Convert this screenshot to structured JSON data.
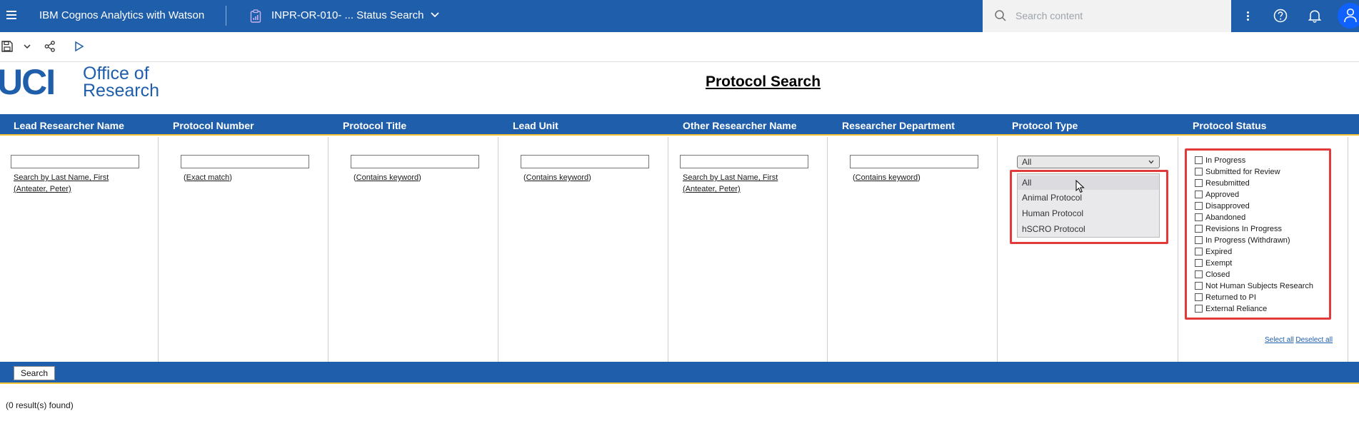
{
  "topbar": {
    "app_title": "IBM Cognos Analytics with Watson",
    "report_title": "INPR-OR-010- ... Status Search",
    "search_placeholder": "Search content",
    "brand_color": "#1f5eaa"
  },
  "logo": {
    "uci": "UCI",
    "office_line1": "Office of",
    "office_line2": "Research"
  },
  "page_title": "Protocol Search",
  "columns": [
    {
      "header": "Lead Researcher Name",
      "hint_line1": "Search by Last Name, First",
      "hint_line2": "(Anteater, Peter)"
    },
    {
      "header": "Protocol Number",
      "hint_prefix": "(",
      "hint_link": "Exact match",
      "hint_suffix": ")"
    },
    {
      "header": "Protocol Title",
      "hint_prefix": "(",
      "hint_link": "Contains keyword",
      "hint_suffix": ")"
    },
    {
      "header": "Lead Unit",
      "hint_prefix": "(",
      "hint_link": "Contains keyword",
      "hint_suffix": ")"
    },
    {
      "header": "Other Researcher Name",
      "hint_line1": "Search by Last Name, First",
      "hint_line2": "(Anteater, Peter)"
    },
    {
      "header": "Researcher Department",
      "hint_prefix": "(",
      "hint_link": "Contains keyword",
      "hint_suffix": ")"
    },
    {
      "header": "Protocol Type"
    },
    {
      "header": "Protocol Status"
    }
  ],
  "protocol_type": {
    "selected": "All",
    "options": [
      "All",
      "Animal Protocol",
      "Human Protocol",
      "hSCRO Protocol"
    ]
  },
  "protocol_status": {
    "options": [
      "In Progress",
      "Submitted for Review",
      "Resubmitted",
      "Approved",
      "Disapproved",
      "Abandoned",
      "Revisions In Progress",
      "In Progress (Withdrawn)",
      "Expired",
      "Exempt",
      "Closed",
      "Not Human Subjects Research",
      "Returned to PI",
      "External Reliance"
    ],
    "select_all": "Select all",
    "deselect_all": "Deselect all"
  },
  "search_button": "Search",
  "results_text": "(0 result(s) found)"
}
